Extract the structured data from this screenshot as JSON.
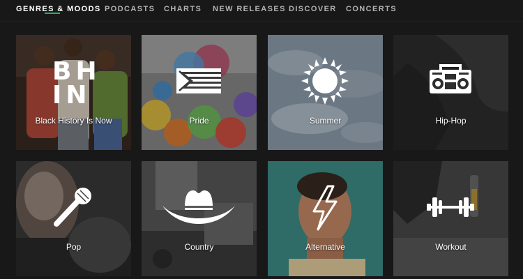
{
  "nav": {
    "tabs": [
      {
        "label": "GENRES & MOODS",
        "active": true
      },
      {
        "label": "PODCASTS",
        "active": false
      },
      {
        "label": "CHARTS",
        "active": false
      },
      {
        "label": "NEW RELEASES",
        "active": false
      },
      {
        "label": "DISCOVER",
        "active": false
      },
      {
        "label": "CONCERTS",
        "active": false
      }
    ],
    "accent_color": "#1db954"
  },
  "tiles": [
    {
      "label": "Black History Is Now",
      "icon": "bhin-logo",
      "icon_text": "BH IN"
    },
    {
      "label": "Pride",
      "icon": "pride-flag-icon"
    },
    {
      "label": "Summer",
      "icon": "sun-icon"
    },
    {
      "label": "Hip-Hop",
      "icon": "boombox-icon"
    },
    {
      "label": "Pop",
      "icon": "microphone-icon"
    },
    {
      "label": "Country",
      "icon": "cowboy-hat-icon"
    },
    {
      "label": "Alternative",
      "icon": "lightning-bolt-icon"
    },
    {
      "label": "Workout",
      "icon": "dumbbell-icon"
    }
  ]
}
